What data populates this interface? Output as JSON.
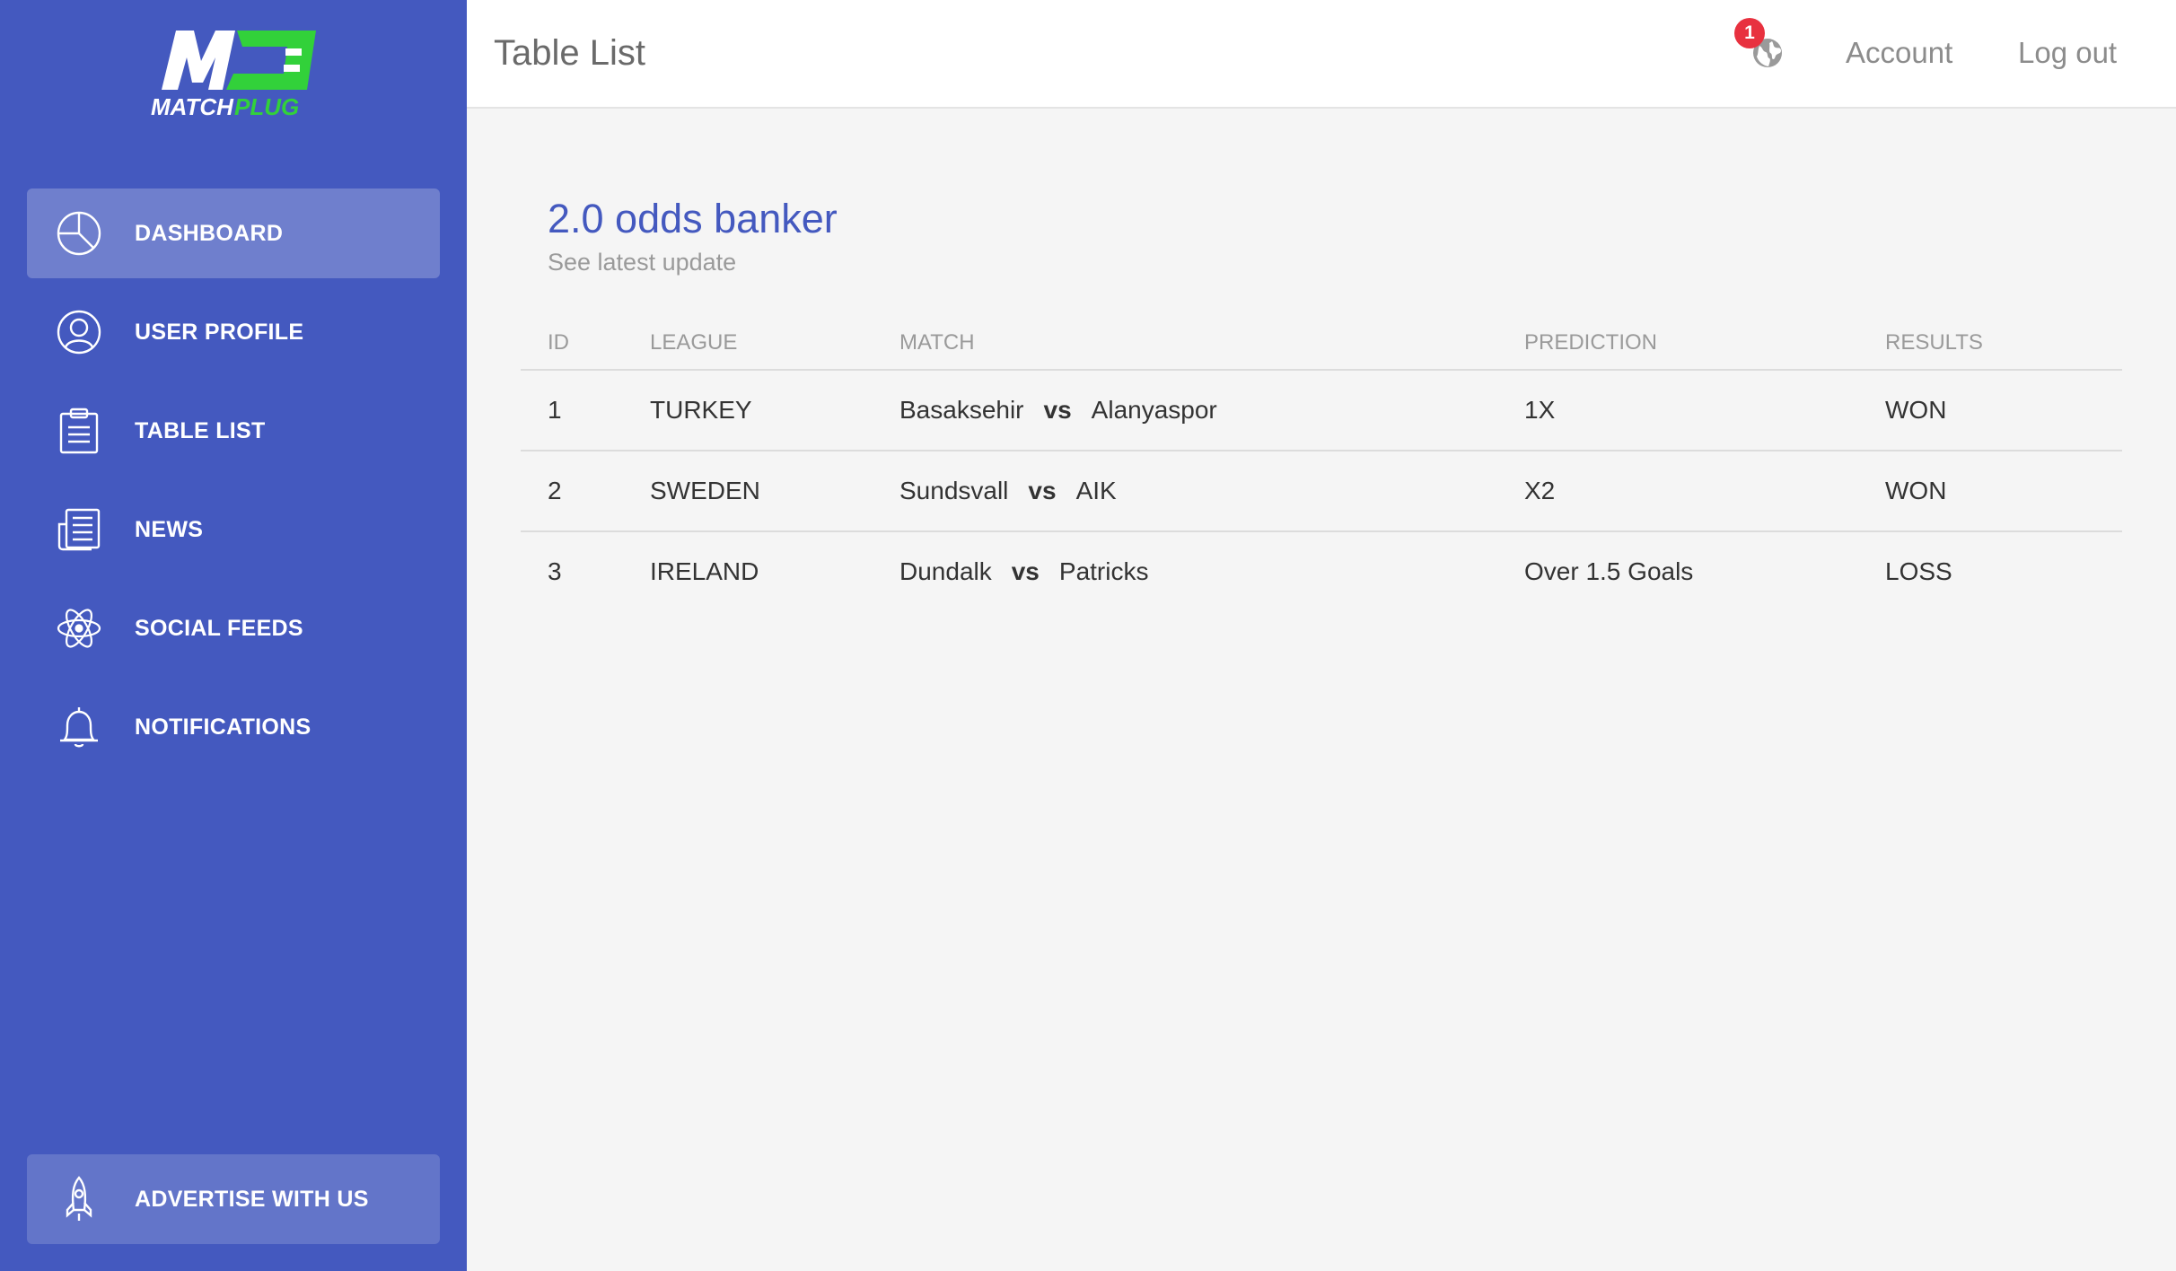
{
  "brand": {
    "logo_text": "MATCHPLUG",
    "logo_mark": "M",
    "colors": {
      "sidebar": "#4459bf",
      "logo_green": "#32d13a",
      "accent": "#4459bf",
      "badge": "#e8313f"
    }
  },
  "sidebar": {
    "items": [
      {
        "label": "DASHBOARD",
        "icon": "pie-chart-icon",
        "active": true
      },
      {
        "label": "USER PROFILE",
        "icon": "user-icon",
        "active": false
      },
      {
        "label": "TABLE LIST",
        "icon": "clipboard-icon",
        "active": false
      },
      {
        "label": "NEWS",
        "icon": "newspaper-icon",
        "active": false
      },
      {
        "label": "SOCIAL FEEDS",
        "icon": "atom-icon",
        "active": false
      },
      {
        "label": "NOTIFICATIONS",
        "icon": "bell-icon",
        "active": false
      }
    ],
    "footer": {
      "label": "ADVERTISE WITH US",
      "icon": "rocket-icon"
    }
  },
  "header": {
    "title": "Table List",
    "notification_count": "1",
    "globe_icon": "globe-icon",
    "account_label": "Account",
    "logout_label": "Log out"
  },
  "card": {
    "title": "2.0 odds banker",
    "subtitle": "See latest update"
  },
  "table": {
    "columns": [
      "ID",
      "LEAGUE",
      "MATCH",
      "PREDICTION",
      "RESULTS"
    ],
    "vs_label": "vs",
    "rows": [
      {
        "id": "1",
        "league": "TURKEY",
        "home": "Basaksehir",
        "away": "Alanyaspor",
        "prediction": "1X",
        "result": "WON"
      },
      {
        "id": "2",
        "league": "SWEDEN",
        "home": "Sundsvall",
        "away": "AIK",
        "prediction": "X2",
        "result": "WON"
      },
      {
        "id": "3",
        "league": "IRELAND",
        "home": "Dundalk",
        "away": "Patricks",
        "prediction": "Over 1.5 Goals",
        "result": "LOSS"
      }
    ]
  }
}
